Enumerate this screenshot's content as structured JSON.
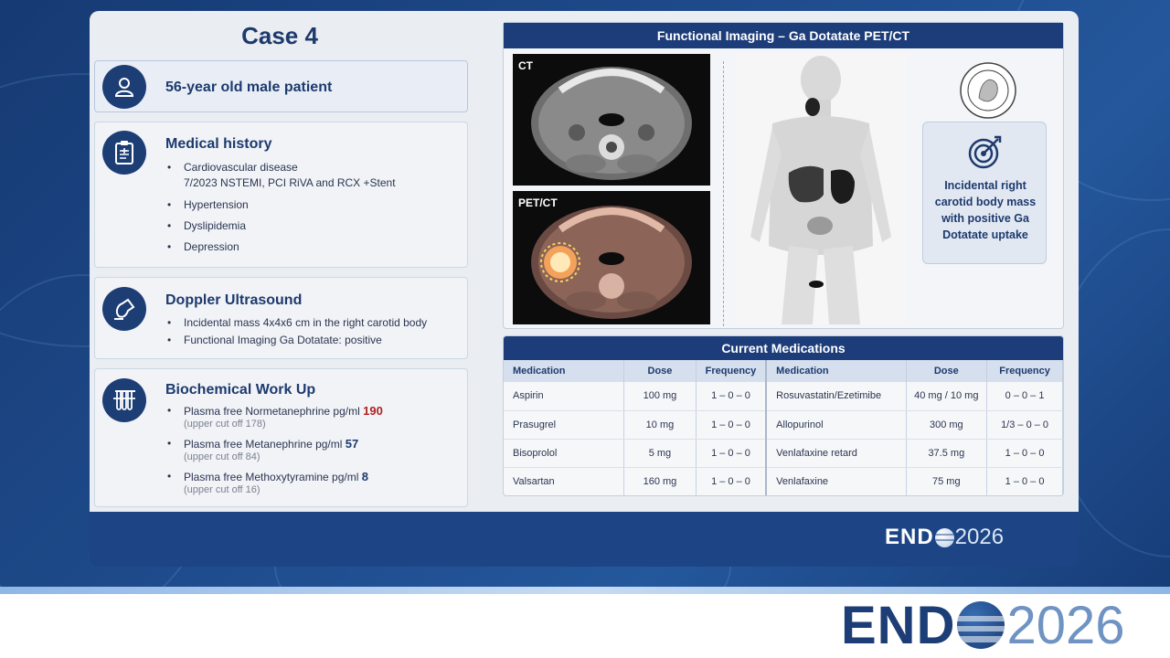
{
  "slide": {
    "case_title": "Case 4",
    "patient": {
      "text": "56-year old male patient",
      "icon": "user-icon"
    },
    "medical_history": {
      "title": "Medical history",
      "icon": "clipboard-icon",
      "items": [
        {
          "text": "Cardiovascular disease",
          "sub": "7/2023 NSTEMI, PCI RiVA and RCX +Stent"
        },
        {
          "text": "Hypertension"
        },
        {
          "text": "Dyslipidemia"
        },
        {
          "text": "Depression"
        }
      ]
    },
    "doppler": {
      "title": "Doppler Ultrasound",
      "icon": "ultrasound-probe-icon",
      "items": [
        "Incidental mass 4x4x6 cm in the right carotid body",
        "Functional Imaging Ga Dotatate: positive"
      ]
    },
    "biochem": {
      "title": "Biochemical Work Up",
      "icon": "test-tubes-icon",
      "items": [
        {
          "label": "Plasma free Normetanephrine pg/ml",
          "value": "190",
          "cutoff": "(upper cut off 178)",
          "value_color": "#b42020"
        },
        {
          "label": "Plasma free Metanephrine pg/ml",
          "value": "57",
          "cutoff": "(upper cut off 84)"
        },
        {
          "label": "Plasma free Methoxytyramine pg/ml",
          "value": "8",
          "cutoff": "(upper cut off 16)"
        }
      ]
    },
    "imaging": {
      "title": "Functional Imaging – Ga Dotatate PET/CT",
      "ct_label": "CT",
      "petct_label": "PET/CT",
      "finding": "Incidental right carotid body mass with positive Ga Dotatate uptake",
      "finding_icon": "target-icon"
    },
    "medications": {
      "title": "Current Medications",
      "headers": [
        "Medication",
        "Dose",
        "Frequency",
        "Medication",
        "Dose",
        "Frequency"
      ],
      "rows": [
        [
          "Aspirin",
          "100 mg",
          "1 – 0 – 0",
          "Rosuvastatin/Ezetimibe",
          "40 mg / 10 mg",
          "0 – 0 – 1"
        ],
        [
          "Prasugrel",
          "10 mg",
          "1 – 0 – 0",
          "Allopurinol",
          "300 mg",
          "1/3 – 0 – 0"
        ],
        [
          "Bisoprolol",
          "5 mg",
          "1 – 0 – 0",
          "Venlafaxine retard",
          "37.5 mg",
          "1 – 0 – 0"
        ],
        [
          "Valsartan",
          "160 mg",
          "1 – 0 – 0",
          "Venlafaxine",
          "75 mg",
          "1 – 0 – 0"
        ]
      ]
    }
  },
  "branding": {
    "word": "END",
    "year": "2026",
    "colors": {
      "navy": "#1c3d75",
      "light_blue": "#6f93c2"
    }
  }
}
